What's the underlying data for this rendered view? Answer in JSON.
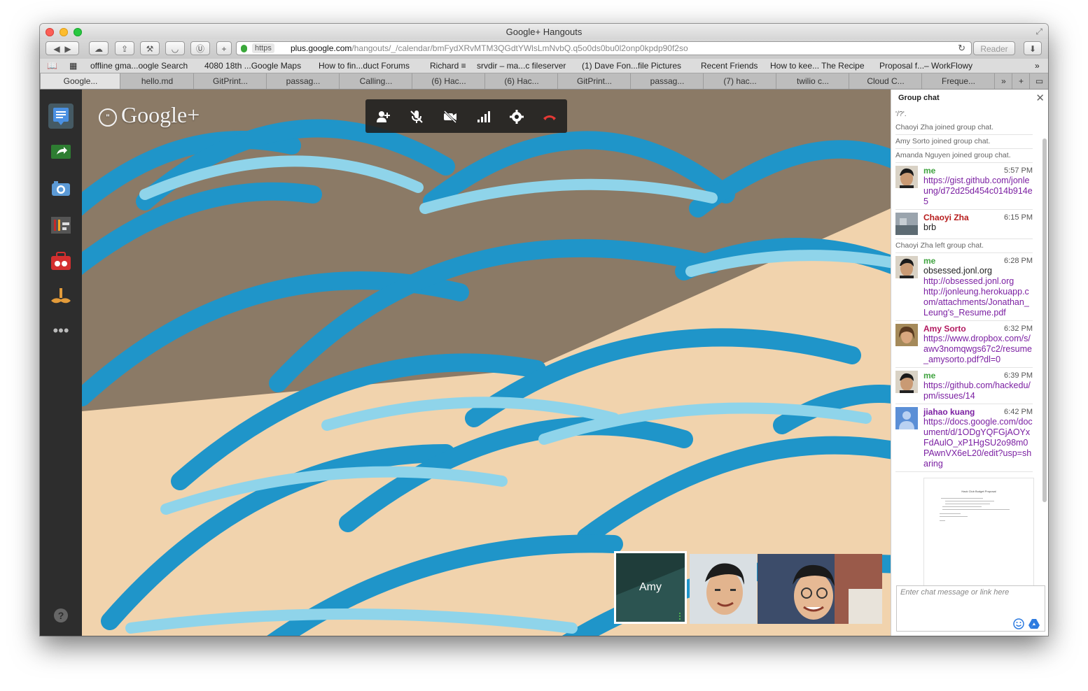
{
  "window": {
    "title": "Google+ Hangouts"
  },
  "toolbar": {
    "back_icon": "back-arrow-icon",
    "forward_icon": "forward-arrow-icon",
    "https_label": "https",
    "url_host": "plus.google.com",
    "url_path": "/hangouts/_/calendar/bmFydXRvMTM3QGdtYWlsLmNvbQ.q5o0ds0bu0l2onp0kpdp90f2so",
    "reader_label": "Reader"
  },
  "bookmarks": [
    "offline gma...oogle Search",
    "4080 18th ...Google Maps",
    "How to fin...duct Forums",
    "Richard ≡",
    "srvdir – ma...c fileserver",
    "(1) Dave Fon...file Pictures",
    "Recent Friends",
    "How to kee... The Recipe",
    "Proposal f...– WorkFlowy"
  ],
  "tabs": [
    "Google...",
    "hello.md",
    "GitPrint...",
    "passag...",
    "Calling...",
    "(6) Hac...",
    "(6) Hac...",
    "GitPrint...",
    "passag...",
    "(7) hac...",
    "twilio c...",
    "Cloud C...",
    "Freque..."
  ],
  "stage": {
    "logo_text": "Google+",
    "logo_bubble": "\"",
    "thumbnail_name": "Amy"
  },
  "chat": {
    "header": "Group chat",
    "input_placeholder": "Enter chat message or link here",
    "top_fragment": "'/?'.",
    "system_1": "Chaoyi Zha joined group chat.",
    "system_2": "Amy Sorto joined group chat.",
    "system_3": "Amanda Nguyen joined group chat.",
    "system_4": "Chaoyi Zha left group chat.",
    "messages": [
      {
        "sender": "me",
        "time": "5:57 PM",
        "lines": [
          "https://gist.github.com/jonleung/d72d25d454c014b914e5"
        ]
      },
      {
        "sender": "Chaoyi Zha",
        "time": "6:15 PM",
        "lines": [
          "brb"
        ]
      },
      {
        "sender": "me",
        "time": "6:28 PM",
        "lines": [
          "obsessed.jonl.org",
          "http://obsessed.jonl.org",
          "http://jonleung.herokuapp.com/attachments/Jonathan_Leung's_Resume.pdf"
        ]
      },
      {
        "sender": "Amy Sorto",
        "time": "6:32 PM",
        "lines": [
          "https://www.dropbox.com/s/awv3nomqwgs67c2/resume_amysorto.pdf?dl=0"
        ]
      },
      {
        "sender": "me",
        "time": "6:39 PM",
        "lines": [
          "https://github.com/hackedu/pm/issues/14"
        ]
      },
      {
        "sender": "jiahao kuang",
        "time": "6:42 PM",
        "lines": [
          "https://docs.google.com/document/d/1ODgYQFGjAOYxFdAulO_xP1HgSU2o98m0PAwnVX6eL20/edit?usp=sharing"
        ]
      }
    ],
    "doc_preview_title": "Hack Club Budget Proposal"
  },
  "colors": {
    "me": "#3fa33f",
    "chaoyi": "#b71c1c",
    "amy": "#b2185f",
    "jiahao": "#7b1fa2",
    "link": "#7b1fa2"
  }
}
